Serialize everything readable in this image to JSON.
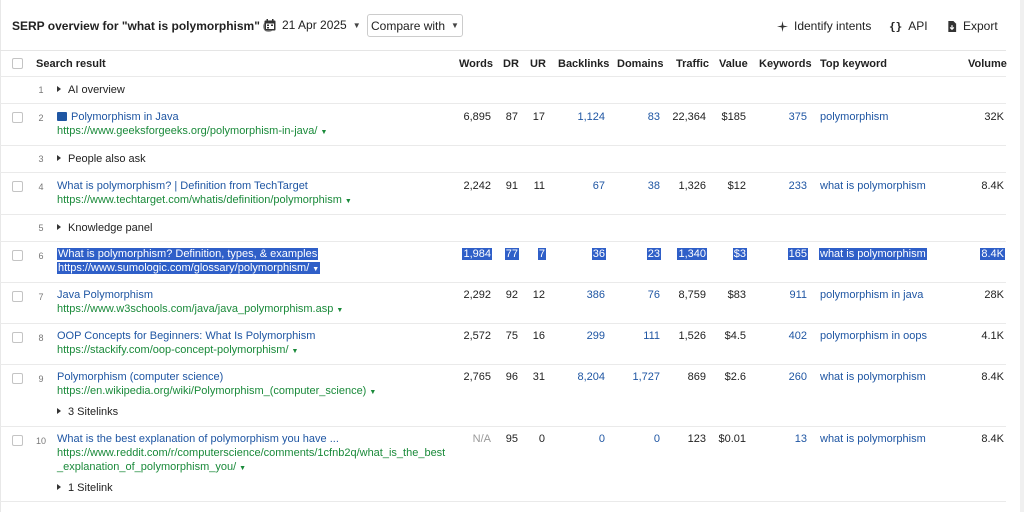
{
  "header": {
    "title": "SERP overview for \"what is polymorphism\"",
    "date": "21 Apr 2025",
    "compare_label": "Compare with",
    "identify_label": "Identify intents",
    "api_label": "API",
    "export_label": "Export"
  },
  "columns": {
    "result": "Search result",
    "words": "Words",
    "dr": "DR",
    "ur": "UR",
    "backlinks": "Backlinks",
    "domains": "Domains",
    "traffic": "Traffic",
    "value": "Value",
    "keywords": "Keywords",
    "top_keyword": "Top keyword",
    "volume": "Volume"
  },
  "rows": [
    {
      "n": "1",
      "label": "AI overview"
    },
    {
      "n": "2",
      "title": "Polymorphism in Java",
      "url": "https://www.geeksforgeeks.org/polymorphism-in-java/",
      "words": "6,895",
      "dr": "87",
      "ur": "17",
      "backlinks": "1,124",
      "domains": "83",
      "traffic": "22,364",
      "value": "$185",
      "keywords": "375",
      "top_keyword": "polymorphism",
      "volume": "32K"
    },
    {
      "n": "3",
      "label": "People also ask"
    },
    {
      "n": "4",
      "title": "What is polymorphism? | Definition from TechTarget",
      "url": "https://www.techtarget.com/whatis/definition/polymorphism",
      "words": "2,242",
      "dr": "91",
      "ur": "11",
      "backlinks": "67",
      "domains": "38",
      "traffic": "1,326",
      "value": "$12",
      "keywords": "233",
      "top_keyword": "what is polymorphism",
      "volume": "8.4K"
    },
    {
      "n": "5",
      "label": "Knowledge panel"
    },
    {
      "n": "6",
      "title": "What is polymorphism? Definition, types, & examples",
      "url": "https://www.sumologic.com/glossary/polymorphism/",
      "words": "1,984",
      "dr": "77",
      "ur": "7",
      "backlinks": "36",
      "domains": "23",
      "traffic": "1,340",
      "value": "$3",
      "keywords": "165",
      "top_keyword": "what is polymorphism",
      "volume": "8.4K"
    },
    {
      "n": "7",
      "title": "Java Polymorphism",
      "url": "https://www.w3schools.com/java/java_polymorphism.asp",
      "words": "2,292",
      "dr": "92",
      "ur": "12",
      "backlinks": "386",
      "domains": "76",
      "traffic": "8,759",
      "value": "$83",
      "keywords": "911",
      "top_keyword": "polymorphism in java",
      "volume": "28K"
    },
    {
      "n": "8",
      "title": "OOP Concepts for Beginners: What Is Polymorphism",
      "url": "https://stackify.com/oop-concept-polymorphism/",
      "words": "2,572",
      "dr": "75",
      "ur": "16",
      "backlinks": "299",
      "domains": "111",
      "traffic": "1,526",
      "value": "$4.5",
      "keywords": "402",
      "top_keyword": "polymorphism in oops",
      "volume": "4.1K"
    },
    {
      "n": "9",
      "title": "Polymorphism (computer science)",
      "url": "https://en.wikipedia.org/wiki/Polymorphism_(computer_science)",
      "sitelinks": "3 Sitelinks",
      "words": "2,765",
      "dr": "96",
      "ur": "31",
      "backlinks": "8,204",
      "domains": "1,727",
      "traffic": "869",
      "value": "$2.6",
      "keywords": "260",
      "top_keyword": "what is polymorphism",
      "volume": "8.4K"
    },
    {
      "n": "10",
      "title": "What is the best explanation of polymorphism you have ...",
      "url_line1": "https://www.reddit.com/r/computerscience/comments/1cfnb2q/what_is_the_best",
      "url_line2": "_explanation_of_polymorphism_you/",
      "sitelinks": "1 Sitelink",
      "words": "N/A",
      "dr": "95",
      "ur": "0",
      "backlinks": "0",
      "domains": "0",
      "traffic": "123",
      "value": "$0.01",
      "keywords": "13",
      "top_keyword": "what is polymorphism",
      "volume": "8.4K"
    }
  ],
  "colors": {
    "link_blue": "#1f56a3",
    "url_green": "#1a8a3a",
    "selection": "#2f5fc8"
  }
}
